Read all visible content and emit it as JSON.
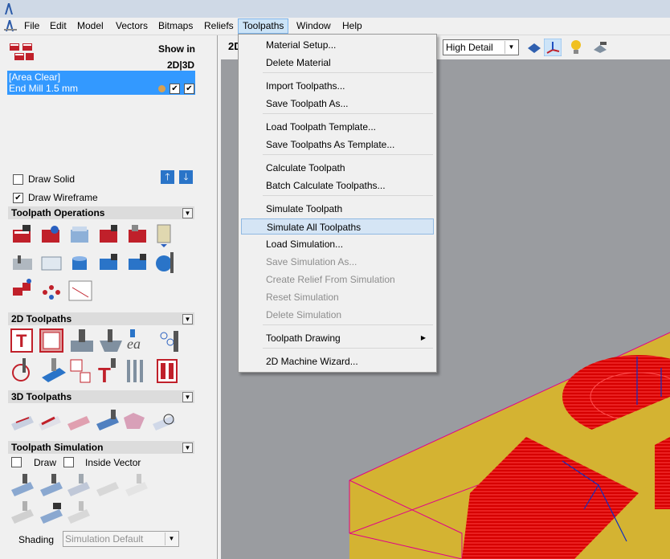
{
  "menubar": {
    "items": [
      "File",
      "Edit",
      "Model",
      "Vectors",
      "Bitmaps",
      "Reliefs",
      "Toolpaths",
      "Window",
      "Help"
    ],
    "active": "Toolpaths"
  },
  "toolpath_list": {
    "show_in_label": "Show in",
    "show_in_modes": "2D|3D",
    "selected_item": {
      "name": "[Area Clear]",
      "tool": "End Mill 1.5 mm"
    }
  },
  "display_options": {
    "draw_solid": {
      "label": "Draw Solid",
      "checked": false
    },
    "draw_wireframe": {
      "label": "Draw Wireframe",
      "checked": true
    }
  },
  "sections": {
    "toolpath_operations": "Toolpath Operations",
    "toolpaths_2d": "2D Toolpaths",
    "toolpaths_3d": "3D Toolpaths",
    "toolpath_simulation": "Toolpath Simulation"
  },
  "simulation": {
    "draw_label": "Draw",
    "inside_vector_label": "Inside Vector",
    "shading_label": "Shading",
    "shading_value": "Simulation Default"
  },
  "toolbar": {
    "view_label": "2D",
    "detail_value": "High Detail"
  },
  "dropdown": {
    "groups": [
      [
        {
          "label": "Material Setup...",
          "enabled": true
        },
        {
          "label": "Delete Material",
          "enabled": true
        }
      ],
      [
        {
          "label": "Import Toolpaths...",
          "enabled": true
        },
        {
          "label": "Save Toolpath As...",
          "enabled": true
        }
      ],
      [
        {
          "label": "Load Toolpath Template...",
          "enabled": true
        },
        {
          "label": "Save Toolpaths As Template...",
          "enabled": true
        }
      ],
      [
        {
          "label": "Calculate Toolpath",
          "enabled": true
        },
        {
          "label": "Batch Calculate Toolpaths...",
          "enabled": true
        }
      ],
      [
        {
          "label": "Simulate Toolpath",
          "enabled": true
        },
        {
          "label": "Simulate All Toolpaths",
          "enabled": true,
          "highlighted": true
        },
        {
          "label": "Load Simulation...",
          "enabled": true
        },
        {
          "label": "Save Simulation As...",
          "enabled": false
        },
        {
          "label": "Create Relief From Simulation",
          "enabled": false
        },
        {
          "label": "Reset Simulation",
          "enabled": false
        },
        {
          "label": "Delete Simulation",
          "enabled": false
        }
      ],
      [
        {
          "label": "Toolpath Drawing",
          "enabled": true,
          "submenu": true
        }
      ],
      [
        {
          "label": "2D Machine Wizard...",
          "enabled": true
        }
      ]
    ]
  },
  "colors": {
    "selection_blue": "#3399ff",
    "material_yellow": "#d4b332",
    "toolpath_red": "#e00000",
    "outline_magenta": "#e0008a",
    "menu_highlight": "#d5e5f5"
  }
}
